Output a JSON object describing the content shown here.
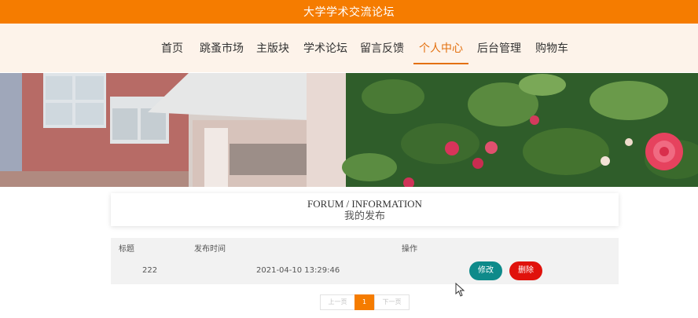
{
  "header": {
    "title": "大学学术交流论坛"
  },
  "nav": {
    "items": [
      {
        "label": "首页"
      },
      {
        "label": "跳蚤市场"
      },
      {
        "label": "主版块"
      },
      {
        "label": "学术论坛"
      },
      {
        "label": "留言反馈"
      },
      {
        "label": "个人中心",
        "active": true
      },
      {
        "label": "后台管理"
      },
      {
        "label": "购物车"
      }
    ]
  },
  "section": {
    "title_en": "FORUM / INFORMATION",
    "title_cn": "我的发布"
  },
  "table": {
    "headers": {
      "title": "标题",
      "time": "发布时间",
      "actions": "操作"
    },
    "rows": [
      {
        "title": "222",
        "time": "2021-04-10 13:29:46",
        "edit": "修改",
        "delete": "删除"
      }
    ]
  },
  "pagination": {
    "prev": "上一页",
    "current": "1",
    "next": "下一页"
  },
  "colors": {
    "brand": "#f57c00",
    "active_nav": "#e3700e",
    "edit_button": "#0e8a8a",
    "delete_button": "#e0120c"
  }
}
